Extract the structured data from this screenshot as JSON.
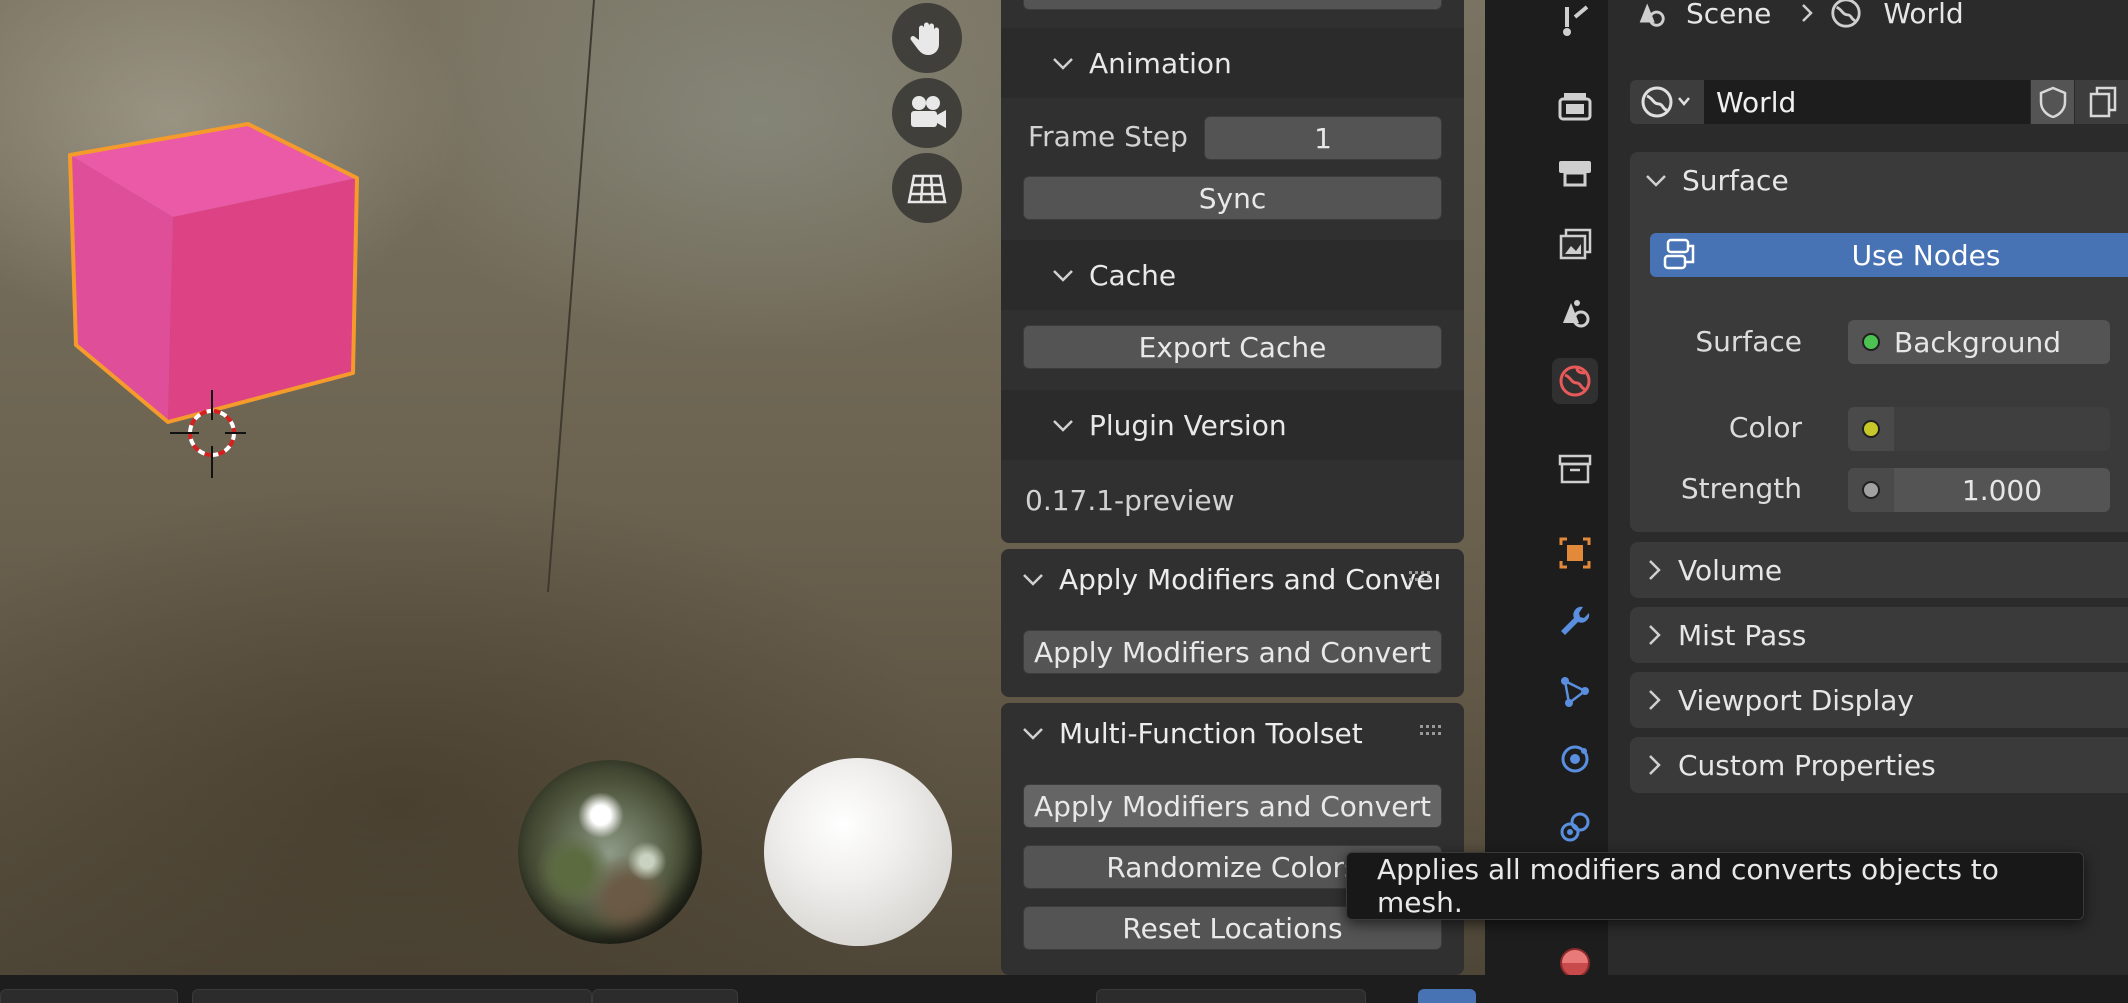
{
  "sidebar": {
    "animation": {
      "title": "Animation",
      "frame_step_label": "Frame Step",
      "frame_step_value": "1",
      "sync_button": "Sync"
    },
    "cache": {
      "title": "Cache",
      "export_button": "Export Cache"
    },
    "plugin_version": {
      "title": "Plugin Version",
      "value": "0.17.1-preview"
    },
    "apply_panel": {
      "title": "Apply Modifiers and Convert",
      "button": "Apply Modifiers and Convert"
    },
    "toolset_panel": {
      "title": "Multi-Function Toolset",
      "apply_button": "Apply Modifiers and Convert",
      "randomize_button": "Randomize Colors",
      "reset_button": "Reset Locations"
    }
  },
  "tooltip": {
    "text": "Applies all modifiers and converts objects to mesh."
  },
  "properties": {
    "breadcrumb": {
      "scene": "Scene",
      "world": "World"
    },
    "world_name": "World",
    "surface_section": "Surface",
    "use_nodes_button": "Use Nodes",
    "surface_label": "Surface",
    "surface_value": "Background",
    "color_label": "Color",
    "strength_label": "Strength",
    "strength_value": "1.000",
    "collapsed_sections": [
      "Volume",
      "Mist Pass",
      "Viewport Display",
      "Custom Properties"
    ]
  },
  "colors": {
    "accent_blue": "#4772b3",
    "selection_orange": "#f59b2c",
    "cube_pink": "#e0488b",
    "socket_green": "#4cc253",
    "socket_yellow": "#c7c729",
    "socket_grey": "#a1a1a1"
  },
  "icons": {
    "viewport_nav": [
      "hand-pan-icon",
      "camera-icon",
      "grid-ortho-icon"
    ],
    "property_tabs": [
      "tool-icon",
      "render-icon",
      "output-icon",
      "view-layer-icon",
      "scene-icon",
      "world-icon",
      "collection-icon",
      "object-icon",
      "modifier-icon",
      "particles-icon",
      "physics-icon",
      "constraints-icon",
      "data-icon",
      "material-icon"
    ]
  }
}
